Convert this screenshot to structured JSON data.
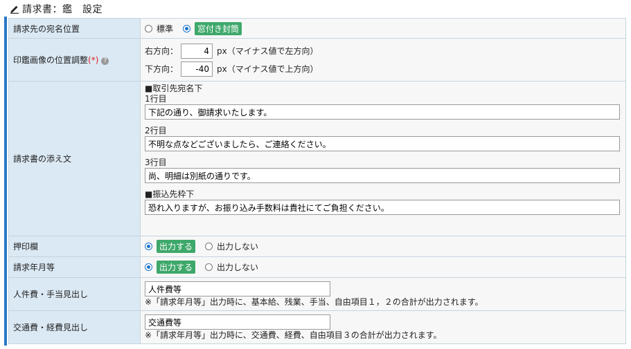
{
  "header": {
    "title": "請求書：鑑　設定",
    "icon": "pencil-icon"
  },
  "rows": {
    "address_position": {
      "label": "請求先の宛名位置",
      "options": [
        "標準",
        "窓付き封筒"
      ],
      "selected": "窓付き封筒"
    },
    "seal_offset": {
      "label": "印鑑画像の位置調整",
      "required_mark": "(*)",
      "right": {
        "label": "右方向：",
        "value": "4",
        "unit": "px（マイナス値で左方向）"
      },
      "down": {
        "label": "下方向：",
        "value": "-40",
        "unit": "px（マイナス値で上方向）"
      }
    },
    "cover_text": {
      "label": "請求書の添え文",
      "section1": "■取引先宛名下",
      "line1_label": "1行目",
      "line1_value": "下記の通り、御請求いたします。",
      "line2_label": "2行目",
      "line2_value": "不明な点などございましたら、ご連絡ください。",
      "line3_label": "3行目",
      "line3_value": "尚、明細は別紙の通りです。",
      "section2": "■振込先枠下",
      "transfer_value": "恐れ入りますが、お振り込み手数料は貴社にてご負担ください。"
    },
    "stamp_box": {
      "label": "押印欄",
      "options": [
        "出力する",
        "出力しない"
      ],
      "selected": "出力する"
    },
    "billing_month": {
      "label": "請求年月等",
      "options": [
        "出力する",
        "出力しない"
      ],
      "selected": "出力する"
    },
    "personnel_heading": {
      "label": "人件費・手当見出し",
      "value": "人件費等",
      "note": "※「請求年月等」出力時に、基本給、残業、手当、自由項目１，２の合計が出力されます。"
    },
    "transport_heading": {
      "label": "交通費・経費見出し",
      "value": "交通費等",
      "note": "※「請求年月等」出力時に、交通費、経費、自由項目３の合計が出力されます。"
    }
  },
  "colors": {
    "label_bg": "#dbe9f4",
    "value_bg": "#f7f7f7",
    "accent": "#2a78c8",
    "selected_tag": "#3ea86a",
    "required": "#dd2222"
  }
}
